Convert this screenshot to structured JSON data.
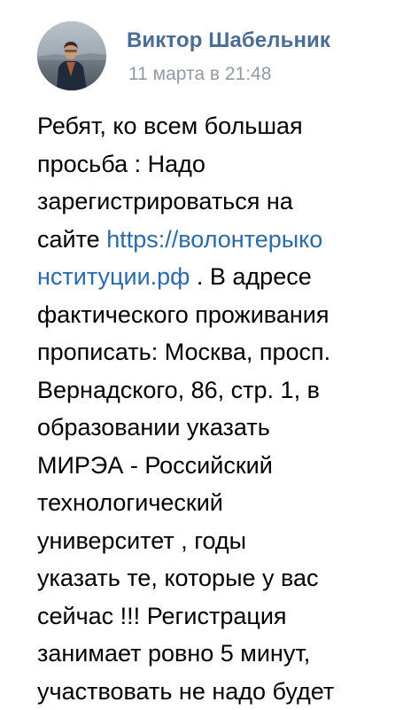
{
  "post": {
    "author": "Виктор Шабельник",
    "date": "11 марта в 21:48",
    "lines": [
      [
        "Ребят, ко всем большая"
      ],
      [
        "просьба : Надо"
      ],
      [
        "зарегистрироваться на"
      ],
      [
        "сайте ",
        "https://волонтерыко"
      ],
      [
        "нституции.рф",
        " . В адресе"
      ],
      [
        "фактического проживания"
      ],
      [
        "прописать: Москва, просп."
      ],
      [
        "Вернадского, 86, стр. 1, в"
      ],
      [
        "образовании указать"
      ],
      [
        "МИРЭА - Российский"
      ],
      [
        "технологический"
      ],
      [
        "университет , годы"
      ],
      [
        "указать те, которые у вас"
      ],
      [
        "сейчас !!! Регистрация"
      ],
      [
        "занимает ровно 5 минут,"
      ],
      [
        "участвовать не надо будет"
      ]
    ],
    "link_color": "#2b6aa8",
    "author_color": "#4a6d95"
  }
}
